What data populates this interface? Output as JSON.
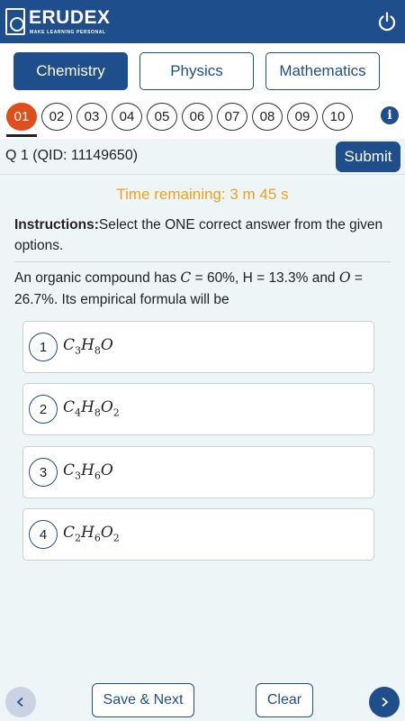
{
  "header": {
    "brand": "ERUDEX",
    "tagline": "MAKE LEARNING PERSONAL",
    "icons": {
      "logo": "erudex-logo",
      "power": "power-icon"
    }
  },
  "subjects": [
    {
      "label": "Chemistry",
      "active": true
    },
    {
      "label": "Physics",
      "active": false
    },
    {
      "label": "Mathematics",
      "active": false
    }
  ],
  "question_nav": {
    "numbers": [
      "01",
      "02",
      "03",
      "04",
      "05",
      "06",
      "07",
      "08",
      "09",
      "10"
    ],
    "active_index": 0,
    "info_icon": "info-icon"
  },
  "question": {
    "qid_label": "Q 1 (QID: 11149650)",
    "submit_label": "Submit",
    "timer": "Time remaining: 3 m 45 s",
    "instructions_bold": "Instructions:",
    "instructions_text": "Select the ONE correct answer from the given options.",
    "text_parts": [
      "An organic compound has ",
      "C",
      " = 60%, H = 13.3% and ",
      "O",
      " = 26.7%. Its empirical formula will be"
    ],
    "options": [
      {
        "number": "1",
        "formula": [
          "C",
          "3",
          "H",
          "8",
          "O",
          ""
        ]
      },
      {
        "number": "2",
        "formula": [
          "C",
          "4",
          "H",
          "8",
          "O",
          "2"
        ]
      },
      {
        "number": "3",
        "formula": [
          "C",
          "3",
          "H",
          "6",
          "O",
          ""
        ]
      },
      {
        "number": "4",
        "formula": [
          "C",
          "2",
          "H",
          "6",
          "O",
          "2"
        ]
      }
    ]
  },
  "footer": {
    "prev_icon": "chevron-left-icon",
    "next_icon": "chevron-right-icon",
    "save_next_label": "Save & Next",
    "clear_label": "Clear"
  },
  "colors": {
    "primary": "#1f4e8c",
    "active_question": "#e04e1c",
    "timer": "#f0a020",
    "background": "#eef5f6"
  }
}
